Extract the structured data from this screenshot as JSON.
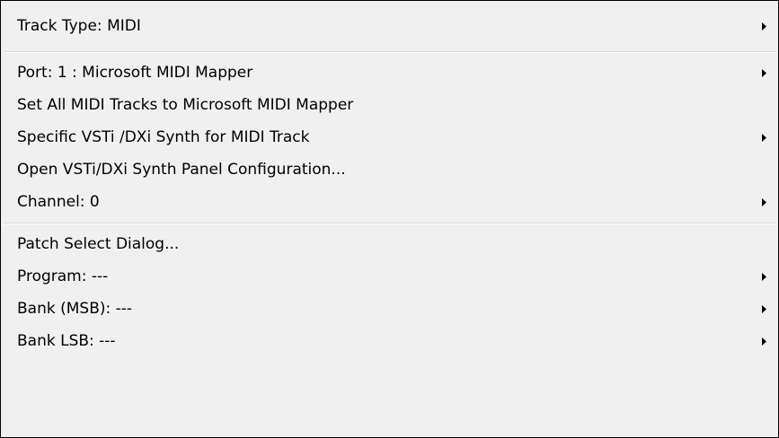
{
  "menu": {
    "items": [
      {
        "label": "Track Type: MIDI",
        "submenu": true
      },
      {
        "label": "Port: 1 : Microsoft MIDI Mapper",
        "submenu": true
      },
      {
        "label": "Set All MIDI Tracks to Microsoft MIDI Mapper",
        "submenu": false
      },
      {
        "label": "Specific VSTi /DXi Synth for MIDI Track",
        "submenu": true
      },
      {
        "label": "Open VSTi/DXi Synth Panel Configuration...",
        "submenu": false
      },
      {
        "label": "Channel: 0",
        "submenu": true
      },
      {
        "label": "Patch Select Dialog...",
        "submenu": false
      },
      {
        "label": "Program: ---",
        "submenu": true
      },
      {
        "label": "Bank (MSB): ---",
        "submenu": true
      },
      {
        "label": "Bank LSB: ---",
        "submenu": true
      }
    ],
    "submenu_icon": "triangle-right-icon",
    "colors": {
      "background": "#f0f0f0",
      "border": "#000000",
      "separator": "#d7d7d7",
      "text": "#000000"
    }
  }
}
